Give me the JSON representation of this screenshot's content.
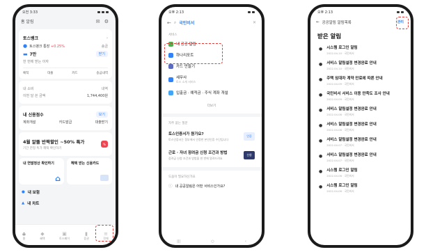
{
  "status": {
    "time": "오전 3:33",
    "time2": "오후 2:13"
  },
  "phone1": {
    "header_left": "홈 알림",
    "bank_title": "토스뱅크",
    "account_name": "토스뱅크 통장",
    "account_rate": "+0.25%",
    "account_action": "송금",
    "account_amount": "7만",
    "account_note": "한 번에 받는 이자",
    "account_btn": "받기",
    "tabs": [
      "예적",
      "대출",
      "카드",
      "송금내역"
    ],
    "row2_label": "내 소비",
    "row2_val": "내역",
    "row3_label": "이번 달 쓴 금액",
    "row3_val": "1,744,400원",
    "credit_title": "내 신용점수",
    "credit_btn": "보기",
    "credit_tabs": [
      "계좌개설",
      "카드발급",
      "대출받기"
    ],
    "promo_title": "4월 알뜰 반짝할인 ~50% 특가",
    "promo_sub": "기간 한정 특가 혜택 확인하기",
    "promo_badge": "%",
    "tile1": "내 연말정산 확인하기",
    "tile2": "혜택 받는 신용카드",
    "list": [
      "내 보험",
      "내 차트"
    ],
    "nav": [
      "홈",
      "혜택",
      "토스페이",
      "증권",
      "전체"
    ]
  },
  "phone2": {
    "query": "국민비서",
    "section": "서비스",
    "results": [
      {
        "label": "내 공공 알림",
        "sub": ""
      },
      {
        "label": "하나리포트",
        "sub": ""
      },
      {
        "label": "카드 만들기",
        "sub": ""
      },
      {
        "label": "세무사",
        "sub": "토스 소개 서비스"
      },
      {
        "label": "입출금 · 예적금 · 주식 계좌 개설",
        "sub": ""
      }
    ],
    "more_label": "더보기",
    "faq_label": "자주 묻는 질문",
    "qa": [
      {
        "title": "토스인증서가 뭔가요?",
        "sub": "토스인증서는 정부에서 인정한 본인인증 수단입니다",
        "img": "인증"
      },
      {
        "title": "근로 · 자녀 장려금 신청 조건과 방법",
        "sub": "장려금 신청 조건과 방법을 한 번에 알려드려요",
        "img": "신청"
      }
    ],
    "help_label": "도움이 필요하신가요",
    "footer_q": "내 공공알림은 어떤 서비스인가요?"
  },
  "phone3": {
    "header": "공공알림 알림목록",
    "manage": "관리",
    "title": "받은 알림",
    "items": [
      {
        "title": "시스템 로그인 알림",
        "date": "2022.04.10 · 국민비서"
      },
      {
        "title": "서비스 알림설정 변경완료 안내",
        "date": "2022.04.10 · 국민비서"
      },
      {
        "title": "주택 임대차 계약 만료에 따른 안내",
        "date": "2022.04.09 · 국민비서"
      },
      {
        "title": "국민비서 서비스 이용 만족도 조사 안내",
        "date": "2022.04.09 · 국민비서"
      },
      {
        "title": "서비스 알림설정 변경완료 안내",
        "date": "2022.04.08 · 국민비서"
      },
      {
        "title": "서비스 알림설정 변경완료 안내",
        "date": "2022.04.08 · 국민비서"
      },
      {
        "title": "서비스 알림설정 변경완료 안내",
        "date": "2022.04.07 · 국민비서"
      },
      {
        "title": "서비스 알림설정 변경완료 안내",
        "date": "2022.04.07 · 국민비서"
      },
      {
        "title": "시스템 로그인 알림",
        "date": "2022.04.06 · 국민비서"
      },
      {
        "title": "시스템 로그인 알림",
        "date": "2022.04.06 · 국민비서"
      }
    ]
  },
  "colors": {
    "accent": "#3182f6",
    "highlight": "#e53935",
    "danger": "#f04452"
  }
}
